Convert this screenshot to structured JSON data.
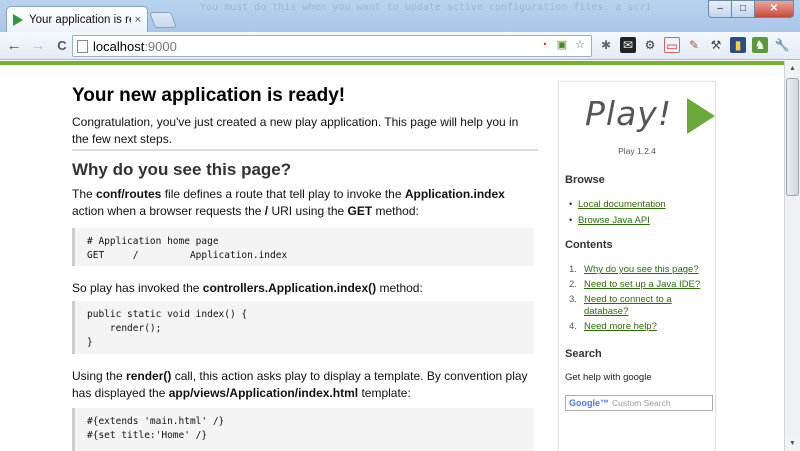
{
  "window": {
    "tab_title": "Your application is ready",
    "tab_close": "×",
    "glass_text": "You must do this when you want to update active configuration files. a script to delete and re-import the project into your workspace since you've seen disk caches.",
    "min_label": "–",
    "max_label": "□",
    "close_label": "✕"
  },
  "toolbar": {
    "back_label": "←",
    "forward_label": "→",
    "reload_label": "C",
    "url_host": "localhost",
    "url_port": ":9000"
  },
  "colors": {
    "accent": "#78b032",
    "link": "#2d6b0c",
    "play_green": "#6aa93a"
  },
  "main": {
    "title": "Your new application is ready!",
    "intro": "Congratulation, you've just created a new play application. This page will help you in the few next steps.",
    "section_title": "Why do you see this page?",
    "p1_prefix": "The ",
    "p1_code1": "conf/routes",
    "p1_mid1": " file defines a route that tell play to invoke the ",
    "p1_code2": "Application.index",
    "p1_mid2": " action when a browser requests the ",
    "p1_code3": "/",
    "p1_mid3": " URI using the ",
    "p1_code4": "GET",
    "p1_suffix": " method:",
    "code1": "# Application home page\nGET     /         Application.index",
    "p2_prefix": "So play has invoked the ",
    "p2_code": "controllers.Application.index()",
    "p2_suffix": " method:",
    "code2": "public static void index() {\n    render();\n}",
    "p3_prefix": "Using the ",
    "p3_code1": "render()",
    "p3_mid": " call, this action asks play to display a template. By convention play has displayed the ",
    "p3_code2": "app/views/Application/index.html",
    "p3_suffix": " template:",
    "code3": "#{extends 'main.html' /}\n#{set title:'Home' /}"
  },
  "sidebar": {
    "logo_text": "Play!",
    "version": "Play 1.2.4",
    "browse_title": "Browse",
    "browse_links": [
      "Local documentation",
      "Browse Java API"
    ],
    "contents_title": "Contents",
    "contents": [
      {
        "num": "1.",
        "label": "Why do you see this page?"
      },
      {
        "num": "2.",
        "label": "Need to set up a Java IDE?"
      },
      {
        "num": "3.",
        "label": "Need to connect to a database?"
      },
      {
        "num": "4.",
        "label": "Need more help?"
      }
    ],
    "search_title": "Search",
    "search_help": "Get help with google",
    "search_google": "Google™",
    "search_placeholder": "Custom Search"
  }
}
